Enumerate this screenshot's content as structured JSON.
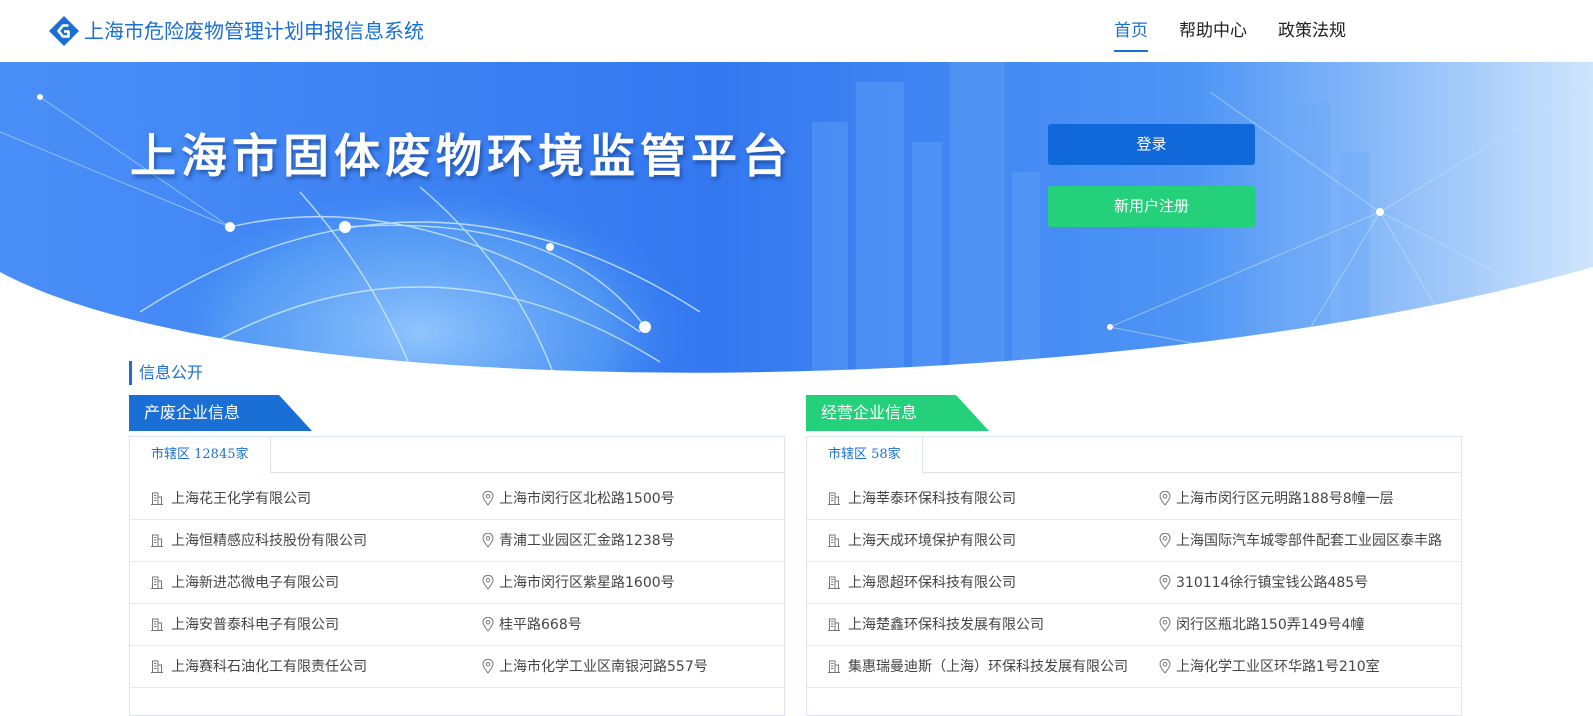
{
  "header": {
    "title": "上海市危险废物管理计划申报信息系统",
    "nav": [
      {
        "label": "首页",
        "active": true
      },
      {
        "label": "帮助中心",
        "active": false
      },
      {
        "label": "政策法规",
        "active": false
      }
    ]
  },
  "banner": {
    "title": "上海市固体废物环境监管平台",
    "login_label": "登录",
    "register_label": "新用户注册"
  },
  "info": {
    "section_title": "信息公开",
    "producers": {
      "tab_label": "产废企业信息",
      "subtab": "市辖区 12845家",
      "rows": [
        {
          "name": "上海花王化学有限公司",
          "address": "上海市闵行区北松路1500号"
        },
        {
          "name": "上海恒精感应科技股份有限公司",
          "address": "青浦工业园区汇金路1238号"
        },
        {
          "name": "上海新进芯微电子有限公司",
          "address": "上海市闵行区紫星路1600号"
        },
        {
          "name": "上海安普泰科电子有限公司",
          "address": "桂平路668号"
        },
        {
          "name": "上海赛科石油化工有限责任公司",
          "address": "上海市化学工业区南银河路557号"
        }
      ]
    },
    "operators": {
      "tab_label": "经营企业信息",
      "subtab": "市辖区 58家",
      "rows": [
        {
          "name": "上海莘泰环保科技有限公司",
          "address": "上海市闵行区元明路188号8幢一层"
        },
        {
          "name": "上海天成环境保护有限公司",
          "address": "上海国际汽车城零部件配套工业园区泰丰路"
        },
        {
          "name": "上海恩超环保科技有限公司",
          "address": "310114徐行镇宝钱公路485号"
        },
        {
          "name": "上海楚鑫环保科技发展有限公司",
          "address": "闵行区瓶北路150弄149号4幢"
        },
        {
          "name": "集惠瑞曼迪斯（上海）环保科技发展有限公司",
          "address": "上海化学工业区环华路1号210室"
        }
      ]
    }
  },
  "colors": {
    "brand_blue": "#1a6fd4",
    "login_blue": "#1168d9",
    "register_green": "#25d07a",
    "banner_blue": "#3a82f2"
  },
  "icons": {
    "logo": "diamond-logo-icon",
    "company": "building-icon",
    "address": "location-pin-icon"
  }
}
